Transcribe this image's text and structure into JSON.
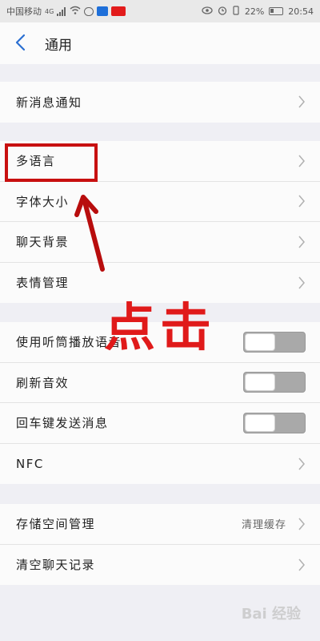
{
  "status_bar": {
    "carrier": "中国移动",
    "network": "4G",
    "battery": "22%",
    "time": "20:54"
  },
  "header": {
    "back_icon": "chevron-left-icon",
    "title": "通用"
  },
  "groups": [
    {
      "items": [
        {
          "label": "新消息通知"
        }
      ]
    },
    {
      "items": [
        {
          "label": "多语言"
        },
        {
          "label": "字体大小"
        },
        {
          "label": "聊天背景"
        },
        {
          "label": "表情管理"
        }
      ]
    },
    {
      "items": [
        {
          "label": "使用听筒播放语音",
          "toggle": "off"
        },
        {
          "label": "刷新音效",
          "toggle": "off"
        },
        {
          "label": "回车键发送消息",
          "toggle": "off"
        },
        {
          "label": "NFC"
        }
      ]
    },
    {
      "items": [
        {
          "label": "存储空间管理",
          "value": "清理缓存"
        },
        {
          "label": "清空聊天记录"
        }
      ]
    }
  ],
  "annotation": {
    "text": "点击",
    "color": "#e01a1a"
  },
  "watermark": "Bai 经验"
}
